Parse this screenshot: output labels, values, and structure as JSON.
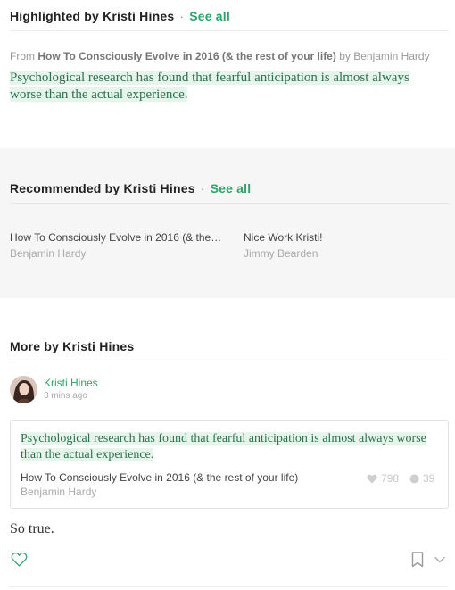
{
  "highlighted": {
    "title": "Highlighted by Kristi Hines",
    "see_all": "See all",
    "from_prefix": "From",
    "source_title": "How To Consciously Evolve in 2016 (& the rest of your life)",
    "by_word": "by",
    "source_author": "Benjamin Hardy",
    "quote": "Psychological research has found that fearful anticipation is almost always worse than the actual experience."
  },
  "recommended": {
    "title": "Recommended by Kristi Hines",
    "see_all": "See all",
    "items": [
      {
        "title": "How To Consciously Evolve in 2016 (& the…",
        "author": "Benjamin Hardy"
      },
      {
        "title": "Nice Work Kristi!",
        "author": "Jimmy Bearden"
      }
    ]
  },
  "more": {
    "title": "More by Kristi Hines",
    "post": {
      "author": "Kristi Hines",
      "time": "3 mins ago",
      "card": {
        "quote": "Psychological research has found that fearful anticipation is almost always worse than the actual experience.",
        "title": "How To Consciously Evolve in 2016 (& the rest of your life)",
        "author": "Benjamin Hardy",
        "hearts": "798",
        "responses": "39"
      },
      "note": "So true."
    }
  },
  "colors": {
    "accent": "#2ea36b",
    "highlight": "#e6f5ec",
    "quote_text": "#2f6f4f",
    "panel": "#f6f6f6"
  },
  "icons": [
    "heart-icon",
    "response-bubble-icon",
    "bookmark-icon",
    "chevron-down-icon"
  ]
}
